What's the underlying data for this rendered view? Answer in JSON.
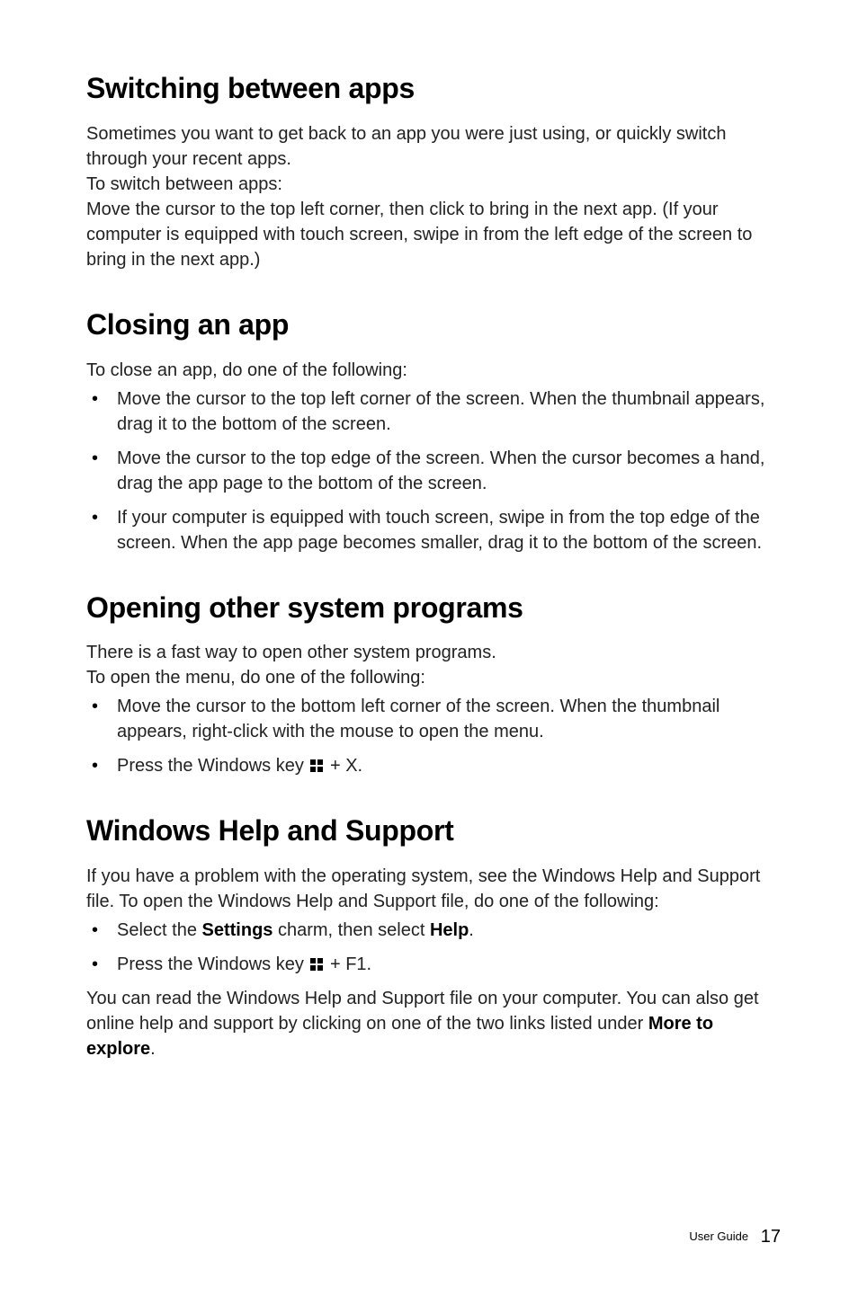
{
  "sec1": {
    "title": "Switching between apps",
    "p1": "Sometimes you want to get back to an app you were just using, or quickly switch through your recent apps.",
    "p2": "To switch between apps:",
    "p3": "Move the cursor to the top left corner, then click to bring in the next app. (If your computer is equipped with touch screen, swipe in from the left edge of the screen to bring in the next app.)"
  },
  "sec2": {
    "title": "Closing an app",
    "intro": "To close an app, do one of the following:",
    "b1": "Move the cursor to the top left corner of the screen. When the thumbnail appears, drag it to the bottom of the screen.",
    "b2": "Move the cursor to the top edge of the screen. When the cursor becomes a hand, drag the app page to the bottom of the screen.",
    "b3": "If your computer is equipped with touch screen, swipe in from the top edge of the screen. When the app page becomes smaller, drag it to the bottom of the screen."
  },
  "sec3": {
    "title": "Opening other system programs",
    "p1": "There is a fast way to open other system programs.",
    "p2": "To open the menu, do one of the following:",
    "b1": "Move the cursor to the bottom left corner of the screen. When the thumbnail appears, right-click with the mouse to open the menu.",
    "b2a": "Press the Windows key ",
    "b2b": " + X."
  },
  "sec4": {
    "title": "Windows Help and Support",
    "p1": "If you have a problem with the operating system, see the Windows Help and Support file. To open the Windows Help and Support file, do one of the following:",
    "b1a": "Select the ",
    "b1b": "Settings",
    "b1c": " charm, then select ",
    "b1d": "Help",
    "b1e": ".",
    "b2a": "Press the Windows key ",
    "b2b": " + F1.",
    "p2a": "You can read the Windows Help and Support file on your computer. You can also get online help and support by clicking on one of the two links listed under ",
    "p2b": "More to explore",
    "p2c": "."
  },
  "footer": {
    "label": "User Guide",
    "page": "17"
  }
}
